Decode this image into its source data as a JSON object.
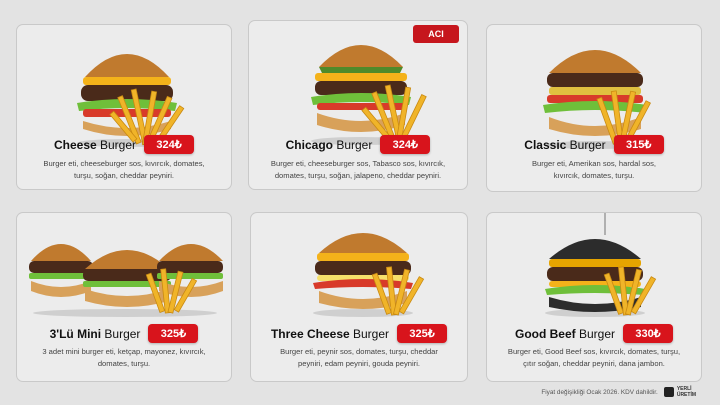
{
  "cards": [
    {
      "title_bold": "Cheese",
      "title_rest": " Burger",
      "price": "324₺",
      "desc_1": "Burger eti, cheeseburger sos, kıvırcık, domates,",
      "desc_2": "turşu, soğan, cheddar peyniri."
    },
    {
      "title_bold": "Chicago",
      "title_rest": " Burger",
      "price": "324₺",
      "tag": "ACI",
      "desc_1": "Burger eti, cheeseburger sos, Tabasco sos, kıvırcık,",
      "desc_2": "domates, turşu, soğan, jalapeno, cheddar peyniri."
    },
    {
      "title_bold": "Classic",
      "title_rest": " Burger",
      "price": "315₺",
      "desc_1": "Burger eti, Amerikan sos, hardal sos,",
      "desc_2": "kıvırcık, domates, turşu."
    },
    {
      "title_bold": "3'Lü Mini",
      "title_rest": " Burger",
      "price": "325₺",
      "desc_1": "3 adet mini burger eti, ketçap, mayonez, kıvırcık,",
      "desc_2": "domates, turşu."
    },
    {
      "title_bold": "Three Cheese",
      "title_rest": " Burger",
      "price": "325₺",
      "desc_1": "Burger eti, peynir sos, domates, turşu, cheddar",
      "desc_2": "peyniri, edam peyniri, gouda peyniri."
    },
    {
      "title_bold": "Good Beef",
      "title_rest": " Burger",
      "price": "330₺",
      "desc_1": "Burger eti, Good Beef sos, kıvırcık, domates, turşu,",
      "desc_2": "çıtır soğan, cheddar peyniri, dana jambon."
    }
  ],
  "footer": {
    "note": "Fiyat değişikliği Ocak 2026. KDV dahildir.",
    "badge_1": "YERLİ",
    "badge_2": "ÜRETİM"
  },
  "colors": {
    "price_bg": "#d8141c",
    "bun": "#c07a2e",
    "patty": "#4a2a1a",
    "fries": "#f0b429",
    "cheese": "#f4b21a",
    "lettuce": "#6fbf3a",
    "tomato": "#d83a2a",
    "black_bun": "#2c2c2c"
  },
  "icons": [
    "burger-image",
    "fries-image",
    "flag-icon",
    "local-production-icon"
  ]
}
